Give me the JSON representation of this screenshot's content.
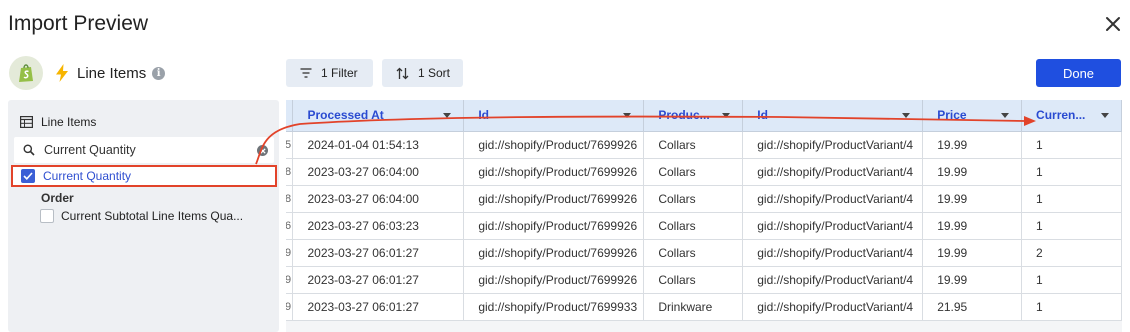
{
  "dialog": {
    "title": "Import Preview"
  },
  "source": {
    "name": "Line Items"
  },
  "left_panel": {
    "header": "Line Items",
    "search": {
      "value": "Current Quantity",
      "placeholder": ""
    },
    "selected_item": "Current Quantity",
    "group": "Order",
    "group_item": "Current Subtotal Line Items Qua..."
  },
  "toolbar": {
    "filter_label": "1 Filter",
    "sort_label": "1 Sort",
    "done_label": "Done"
  },
  "table": {
    "columns": [
      "",
      "Processed At",
      "Id",
      "Produc...",
      "Id",
      "Price",
      "Curren..."
    ],
    "rows": [
      [
        "5",
        "2024-01-04 01:54:13",
        "gid://shopify/Product/7699926",
        "Collars",
        "gid://shopify/ProductVariant/4",
        "19.99",
        "1"
      ],
      [
        "8",
        "2023-03-27 06:04:00",
        "gid://shopify/Product/7699926",
        "Collars",
        "gid://shopify/ProductVariant/4",
        "19.99",
        "1"
      ],
      [
        "8",
        "2023-03-27 06:04:00",
        "gid://shopify/Product/7699926",
        "Collars",
        "gid://shopify/ProductVariant/4",
        "19.99",
        "1"
      ],
      [
        "6",
        "2023-03-27 06:03:23",
        "gid://shopify/Product/7699926",
        "Collars",
        "gid://shopify/ProductVariant/4",
        "19.99",
        "1"
      ],
      [
        "9",
        "2023-03-27 06:01:27",
        "gid://shopify/Product/7699926",
        "Collars",
        "gid://shopify/ProductVariant/4",
        "19.99",
        "2"
      ],
      [
        "9",
        "2023-03-27 06:01:27",
        "gid://shopify/Product/7699926",
        "Collars",
        "gid://shopify/ProductVariant/4",
        "19.99",
        "1"
      ],
      [
        "9",
        "2023-03-27 06:01:27",
        "gid://shopify/Product/7699933",
        "Drinkware",
        "gid://shopify/ProductVariant/4",
        "21.95",
        "1"
      ]
    ]
  },
  "colors": {
    "accent": "#1f4fe0",
    "highlight": "#e2432a",
    "header_bg": "#dde9f8"
  },
  "icons": [
    "close-icon",
    "shopify-icon",
    "bolt-icon",
    "info-icon",
    "table-icon",
    "search-icon",
    "clear-icon",
    "check-icon",
    "filter-icon",
    "sort-icon",
    "caret-down-icon"
  ]
}
